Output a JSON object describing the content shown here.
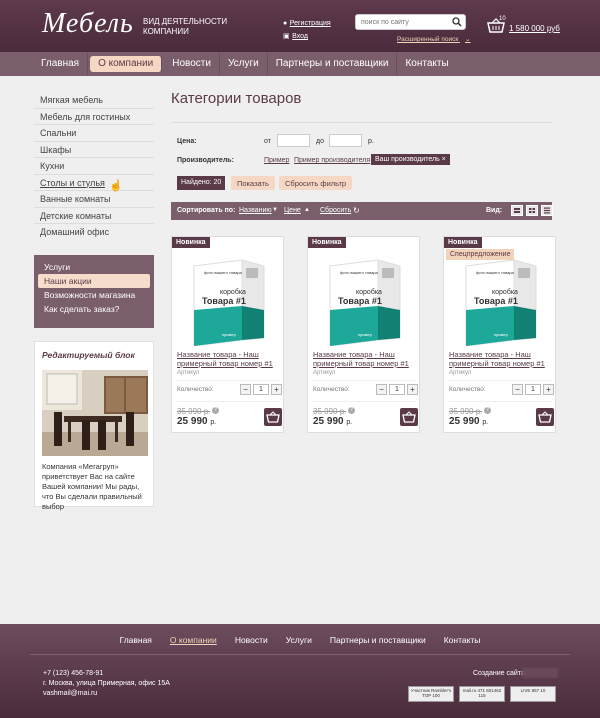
{
  "header": {
    "logo": "Мебель",
    "tagline": "ВИД ДЕЯТЕЛЬНОСТИ КОМПАНИИ",
    "register": "Регистрация",
    "login": "Вход",
    "search_placeholder": "поиск по сайту",
    "advanced_search": "Расширенный поиск",
    "cart_count": "10",
    "cart_total": "1 580 000 руб"
  },
  "nav": [
    "Главная",
    "О компании",
    "Новости",
    "Услуги",
    "Партнеры и поставщики",
    "Контакты"
  ],
  "nav_active": "О компании",
  "sidebar": {
    "categories": [
      "Мягкая мебель",
      "Мебель для гостиных",
      "Спальни",
      "Шкафы",
      "Кухни",
      "Столы и стулья",
      "Ванные комнаты",
      "Детские комнаты",
      "Домашний офис"
    ],
    "box": [
      "Услуги",
      "Наши акции",
      "Возможности магазина",
      "Как сделать заказ?"
    ],
    "box_active": "Наши акции",
    "edit_title": "Редактируемый блок",
    "edit_text": "Компания «Мегагруп» приветствует Вас на сайте Вашей компании! Мы рады, что Вы сделали правильный выбор"
  },
  "main": {
    "title": "Категории товаров",
    "filter": {
      "price_label": "Цена:",
      "from": "от",
      "to": "до",
      "currency": "р.",
      "maker_label": "Производитель:",
      "maker_1": "Пример",
      "maker_2": "Пример производителя",
      "maker_selected": "Ваш производитель ×",
      "found": "Найдено: 20",
      "show": "Показать",
      "reset": "Сбросить фильтр"
    },
    "sort": {
      "label": "Сортировать по:",
      "by_name": "Названию",
      "by_price": "Цене",
      "reset": "Сбросить",
      "view_label": "Вид:"
    },
    "products": [
      {
        "badge": "Новинка",
        "special": "",
        "name": "Название товара - Наш примерный товар номер #1",
        "article": "Артикул",
        "qty_label": "Количество:",
        "qty": "1",
        "old_price": "35 990 р.",
        "price": "25 990",
        "price_cur": "р."
      },
      {
        "badge": "Новинка",
        "special": "",
        "name": "Название товара - Наш примерный товар номер #1",
        "article": "Артикул",
        "qty_label": "Количество:",
        "qty": "1",
        "old_price": "35 990 р.",
        "price": "25 990",
        "price_cur": "р."
      },
      {
        "badge": "Новинка",
        "special": "Спецпредложение",
        "name": "Название товара - Наш примерный товар номер #1",
        "article": "Артикул",
        "qty_label": "Количество:",
        "qty": "1",
        "old_price": "35 990 р.",
        "price": "25 990",
        "price_cur": "р."
      }
    ],
    "box_photo_label": "фото вашего товара",
    "box_title_1": "коробка",
    "box_title_2": "Товара #1",
    "box_sample": "пример"
  },
  "footer": {
    "nav": [
      "Главная",
      "О компании",
      "Новости",
      "Услуги",
      "Партнеры и поставщики",
      "Контакты"
    ],
    "nav_active": "О компании",
    "phone": "+7 (123) 456-78-91",
    "address": "г. Москва, улица Примерная, офис 15А",
    "email": "vashmail@mai.ru",
    "created": "Создание сайта",
    "counter1": "Участник Rambler's TOP 100",
    "counter2": "mail.ru 471 601462 115",
    "counter3": "LIVE 857 10"
  },
  "colors": {
    "brand": "#5a3a48",
    "nav": "#7a5e6c",
    "accent": "#f5d8c4"
  }
}
